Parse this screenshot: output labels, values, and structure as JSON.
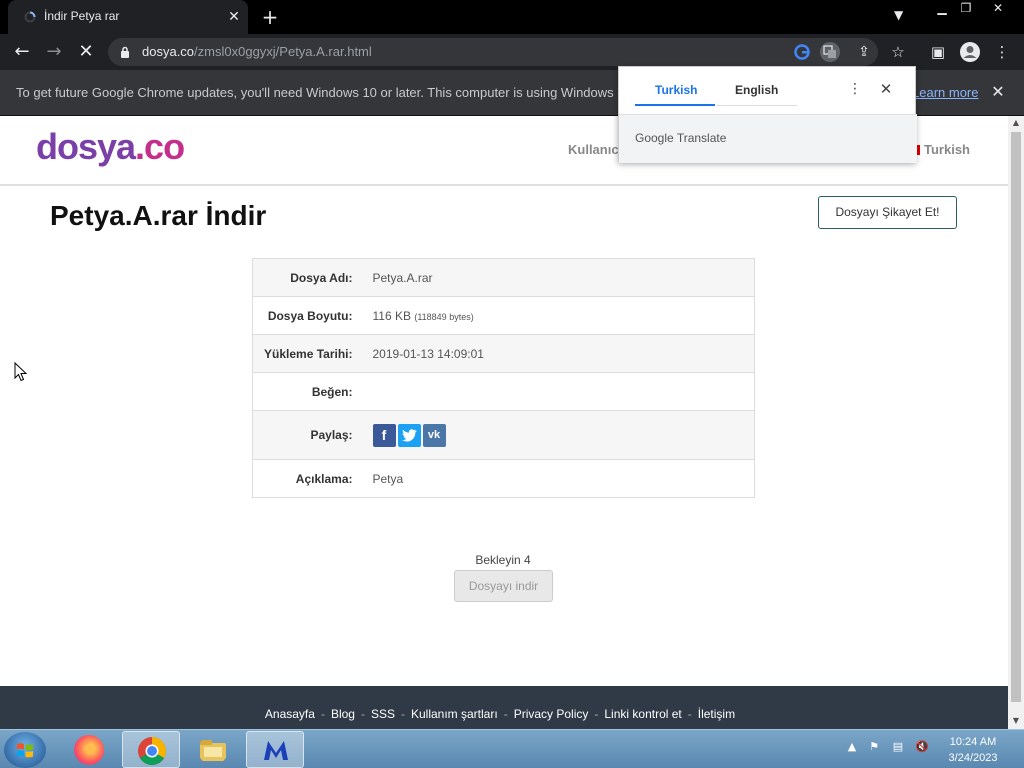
{
  "browser": {
    "tab_title": "İndir Petya rar",
    "tab_close": "✕",
    "new_tab": "+",
    "url_host": "dosya.co",
    "url_path": "/zmsl0x0ggyxj/Petya.A.rar.html",
    "infobar_text": "To get future Google Chrome updates, you'll need Windows 10 or later. This computer is using Windows 7.",
    "infobar_link": "Learn more",
    "infobar_close": "✕"
  },
  "site": {
    "logo_main": "dosya",
    "logo_tld": ".co",
    "nav_user": "Kullanıcı",
    "nav_lang": "Turkish",
    "page_title": "Petya.A.rar İndir",
    "complain_button": "Dosyayı Şikayet Et!",
    "file_info": [
      {
        "label": "Dosya Adı:",
        "value": "Petya.A.rar"
      },
      {
        "label": "Dosya Boyutu:",
        "value": "116 KB",
        "extra": "(118849 bytes)"
      },
      {
        "label": "Yükleme Tarihi:",
        "value": "2019-01-13 14:09:01"
      },
      {
        "label": "Beğen:",
        "value": ""
      },
      {
        "label": "Paylaş:",
        "value": ""
      },
      {
        "label": "Açıklama:",
        "value": "Petya"
      }
    ],
    "share": {
      "facebook": "f",
      "twitter": "t",
      "vk": "vk"
    },
    "wait_text": "Bekleyin 4",
    "download_button": "Dosyayı indir",
    "footer_links": [
      "Anasayfa",
      "Blog",
      "SSS",
      "Kullanım şartları",
      "Privacy Policy",
      "Linki kontrol et",
      "İletişim"
    ],
    "footer_sep": "-"
  },
  "translate_popup": {
    "tab_source": "Turkish",
    "tab_target": "English",
    "brand": "Google Translate",
    "menu": "⋮",
    "close": "✕"
  },
  "taskbar": {
    "time": "10:24 AM",
    "date": "3/24/2023"
  },
  "colors": {
    "accent": "#1a73e8",
    "logo_purple": "#7b3fa8",
    "logo_pink": "#c42f8c",
    "footer_bg": "#2f3a46"
  }
}
